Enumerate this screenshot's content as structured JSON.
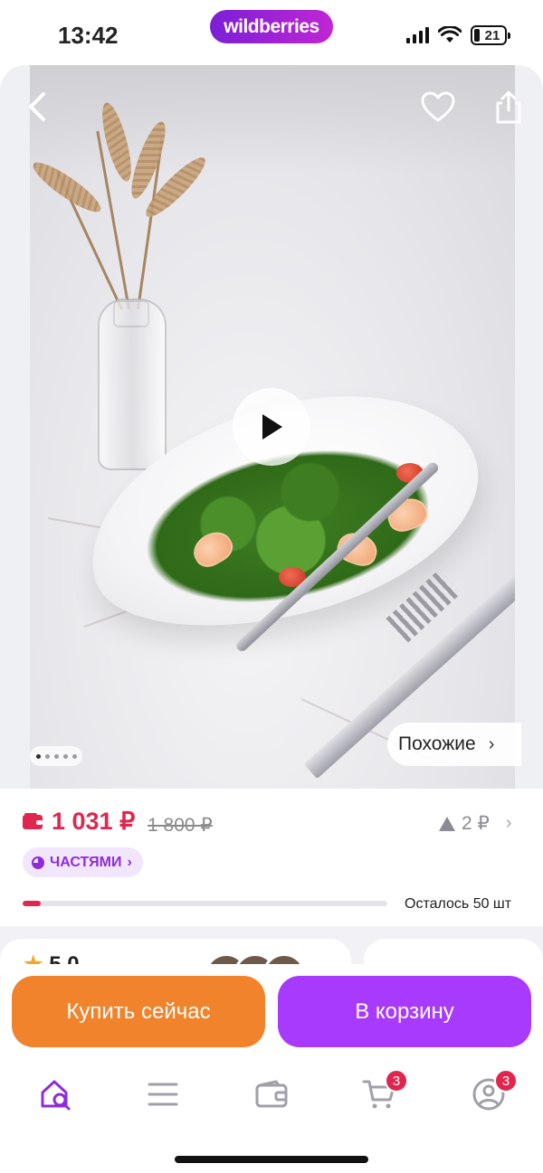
{
  "status_bar": {
    "time": "13:42",
    "brand": "wildberries",
    "battery": "21"
  },
  "gallery": {
    "similar_label": "Похожие",
    "similar_chevron": "›",
    "dots_count": 5,
    "active_dot": 0
  },
  "price": {
    "current": "1 031 ₽",
    "old": "1 800 ₽",
    "points": "2 ₽",
    "installments_label": "ЧАСТЯМИ",
    "installments_chevron": "›",
    "stock_progress_percent": 5,
    "remaining_text": "Осталось 50 шт"
  },
  "peek": {
    "rating_value": "5.0"
  },
  "actions": {
    "buy_now": "Купить сейчас",
    "add_to_cart": "В корзину"
  },
  "tab_bar": {
    "cart_badge": "3",
    "profile_badge": "3"
  },
  "colors": {
    "brand_purple": "#a73afd",
    "buy_orange": "#f0832b",
    "price_red": "#e0264f"
  },
  "icons": [
    "back-icon",
    "heart-icon",
    "share-icon",
    "play-icon",
    "wallet-icon",
    "home-search-icon",
    "catalog-icon",
    "wallet-tab-icon",
    "cart-icon",
    "profile-icon"
  ]
}
